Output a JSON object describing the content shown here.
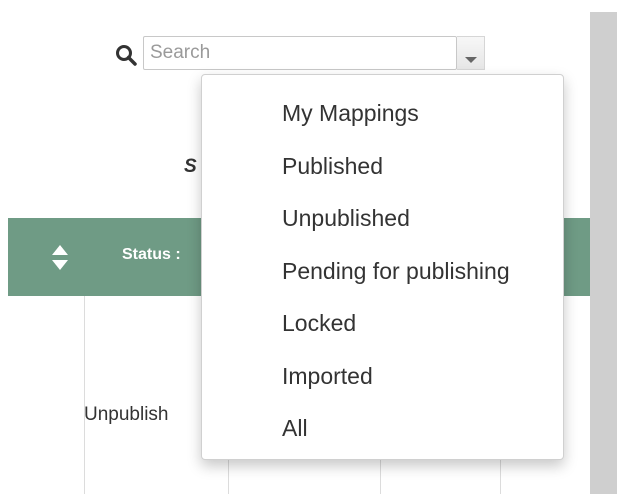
{
  "search": {
    "placeholder": "Search",
    "value": ""
  },
  "heading_fragment": "S",
  "table": {
    "status_header": "Status :",
    "cell_status": "Unpublish"
  },
  "filter_menu": {
    "items": [
      {
        "label": "My Mappings"
      },
      {
        "label": "Published"
      },
      {
        "label": "Unpublished"
      },
      {
        "label": "Pending for publishing"
      },
      {
        "label": "Locked"
      },
      {
        "label": "Imported"
      },
      {
        "label": "All"
      }
    ]
  },
  "colors": {
    "table_header": "#6f9b85",
    "text": "#333333",
    "scroll_strip": "#cfcfcf"
  },
  "icons": {
    "search": "search-icon",
    "toggle": "chevron-down-icon",
    "sort": "sort-icon"
  }
}
